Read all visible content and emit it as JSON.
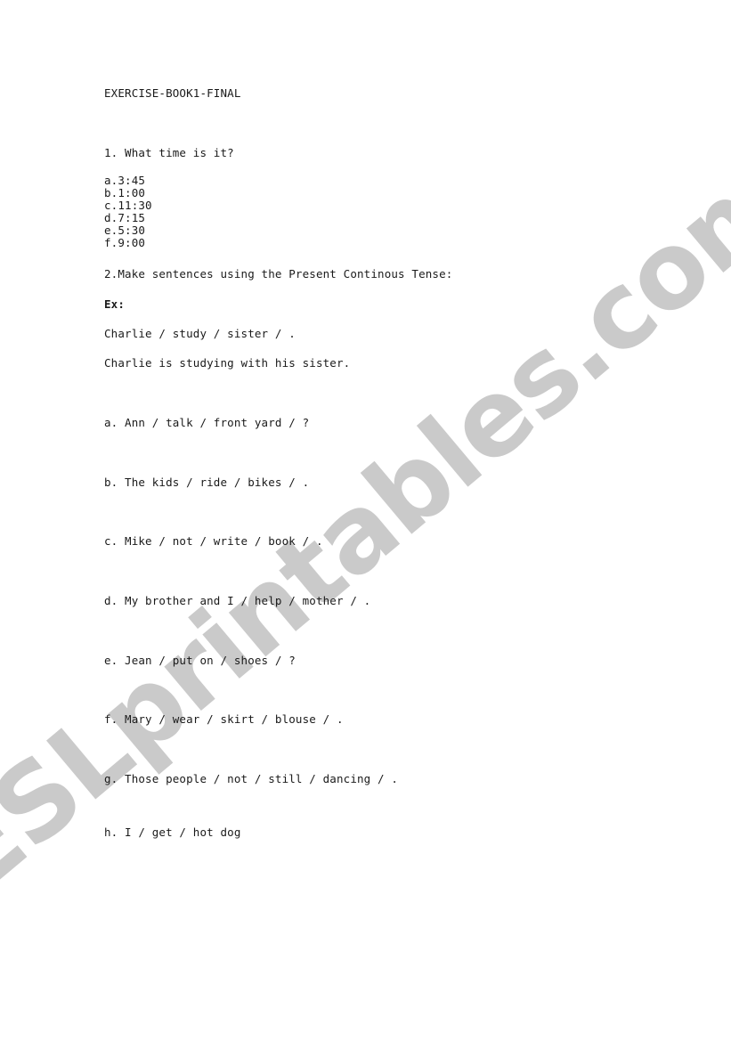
{
  "document": {
    "title": "EXERCISE-BOOK1-FINAL",
    "watermark": "ESLprintables.com",
    "section1": {
      "heading": "1. What time is it?",
      "items": [
        "a.3:45",
        "b.1:00",
        "c.11:30",
        "d.7:15",
        "e.5:30",
        "f.9:00"
      ]
    },
    "section2": {
      "heading": "2.Make sentences using the Present Continous Tense:",
      "example_label": "Ex:",
      "example_prompt": "Charlie / study / sister / .",
      "example_answer": "Charlie is studying with his sister.",
      "items": [
        "a. Ann / talk / front yard / ?",
        "b. The kids / ride / bikes / .",
        "c. Mike / not / write / book / .",
        "d. My brother and I / help / mother / .",
        "e. Jean / put on / shoes / ?",
        "f. Mary / wear / skirt / blouse / .",
        "g. Those people / not / still / dancing / .",
        "h. I / get / hot dog"
      ]
    }
  }
}
